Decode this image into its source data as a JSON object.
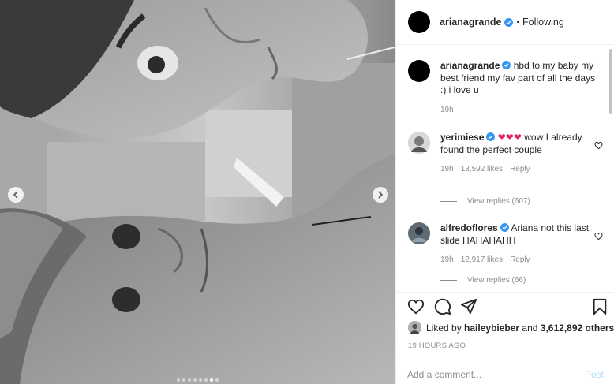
{
  "header": {
    "username": "arianagrande",
    "separator": "•",
    "following_label": "Following"
  },
  "caption": {
    "username": "arianagrande",
    "text": "hbd to my baby my best friend my fav part of all the days :) i love u",
    "time": "19h"
  },
  "comments": [
    {
      "username": "yerimiese",
      "emoji": "❤❤❤",
      "text": "wow I already found the perfect couple",
      "time": "19h",
      "likes": "13,592 likes",
      "reply_label": "Reply",
      "view_replies": "View replies (607)"
    },
    {
      "username": "alfredoflores",
      "text": "Ariana not this last slide HAHAHAHH",
      "time": "19h",
      "likes": "12,917 likes",
      "reply_label": "Reply",
      "view_replies": "View replies (66)"
    }
  ],
  "likes": {
    "prefix": "Liked by",
    "user": "haileybieber",
    "connector": "and",
    "count": "3,612,892 others"
  },
  "timestamp": "19 HOURS AGO",
  "add_comment": {
    "placeholder": "Add a comment...",
    "post_label": "Post"
  },
  "carousel": {
    "total": 8,
    "active_index": 6
  },
  "icons": {
    "like": "heart-icon",
    "comment": "comment-icon",
    "share": "share-icon",
    "save": "bookmark-icon",
    "verified": "verified-badge-icon",
    "prev": "chevron-left-icon",
    "next": "chevron-right-icon"
  },
  "colors": {
    "verified": "#3897f0",
    "post_button": "#b2dffc",
    "heart_emoji": "#e0245e"
  }
}
